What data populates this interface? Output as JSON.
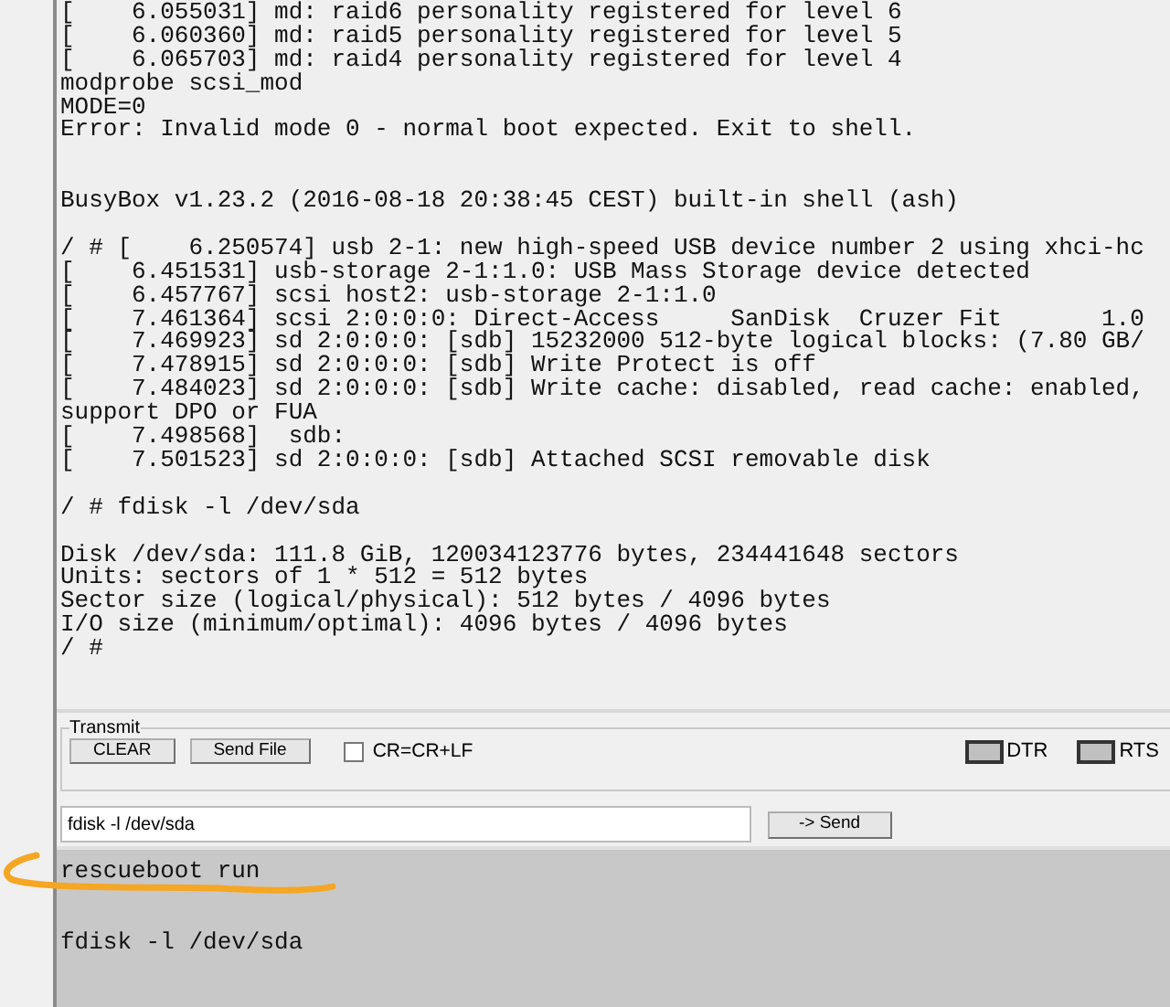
{
  "terminal": {
    "blocks": [
      {
        "gap_after": true,
        "wide_gap": true,
        "lines": [
          "[    6.055031] md: raid6 personality registered for level 6",
          "[    6.060360] md: raid5 personality registered for level 5",
          "[    6.065703] md: raid4 personality registered for level 4",
          "modprobe scsi_mod",
          "MODE=0",
          "Error: Invalid mode 0 - normal boot expected. Exit to shell."
        ]
      },
      {
        "gap_after": true,
        "lines": [
          "BusyBox v1.23.2 (2016-08-18 20:38:45 CEST) built-in shell (ash)"
        ]
      },
      {
        "gap_after": true,
        "lines": [
          "/ # [    6.250574] usb 2-1: new high-speed USB device number 2 using xhci-hc",
          "[    6.451531] usb-storage 2-1:1.0: USB Mass Storage device detected",
          "[    6.457767] scsi host2: usb-storage 2-1:1.0",
          "[    7.461364] scsi 2:0:0:0: Direct-Access     SanDisk  Cruzer Fit       1.0",
          "[    7.469923] sd 2:0:0:0: [sdb] 15232000 512-byte logical blocks: (7.80 GB/",
          "[    7.478915] sd 2:0:0:0: [sdb] Write Protect is off",
          "[    7.484023] sd 2:0:0:0: [sdb] Write cache: disabled, read cache: enabled,",
          "support DPO or FUA",
          "[    7.498568]  sdb:",
          "[    7.501523] sd 2:0:0:0: [sdb] Attached SCSI removable disk"
        ]
      },
      {
        "gap_after": true,
        "lines": [
          "/ # fdisk -l /dev/sda"
        ]
      },
      {
        "lines": [
          "Disk /dev/sda: 111.8 GiB, 120034123776 bytes, 234441648 sectors",
          "Units: sectors of 1 * 512 = 512 bytes",
          "Sector size (logical/physical): 512 bytes / 4096 bytes",
          "I/O size (minimum/optimal): 4096 bytes / 4096 bytes",
          "/ #"
        ]
      }
    ]
  },
  "transmit": {
    "title": "Transmit",
    "buttons": [
      "CLEAR",
      "Send File"
    ],
    "checkbox": {
      "label": "CR=CR+LF",
      "checked": false
    },
    "indicators": [
      {
        "label": "DTR",
        "on": false
      },
      {
        "label": "RTS",
        "on": false
      }
    ]
  },
  "command": {
    "value": "fdisk -l /dev/sda",
    "send_button": "-> Send"
  },
  "history": {
    "blocks": [
      {
        "gap_after": true,
        "wide_gap": true,
        "lines": [
          "rescueboot run"
        ]
      },
      {
        "lines": [
          "fdisk -l /dev/sda"
        ]
      }
    ]
  }
}
